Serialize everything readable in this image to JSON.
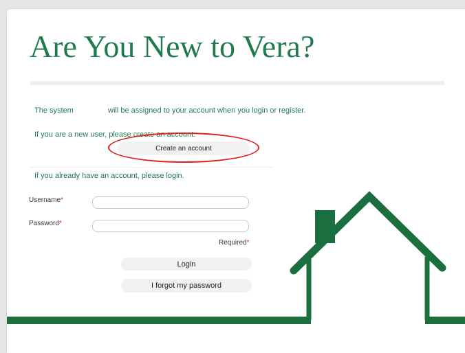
{
  "page": {
    "title": "Are You New to Vera?",
    "system_text_left": "The system",
    "system_text_right": "will be assigned to your account when you login or register.",
    "new_user_text": "If you are a new user, please create an account.",
    "create_account_label": "Create an account",
    "existing_user_text": "If you already have an account, please login."
  },
  "form": {
    "username_label": "Username",
    "password_label": "Password",
    "required_marker": "*",
    "required_note": "Required",
    "username_value": "",
    "password_value": "",
    "login_label": "Login",
    "forgot_label": "I forgot my password"
  },
  "colors": {
    "brand_green": "#1f7a4d",
    "house_green": "#1b6e3e",
    "highlight_red": "#e0201f"
  },
  "icons": {
    "house": "house-icon"
  }
}
